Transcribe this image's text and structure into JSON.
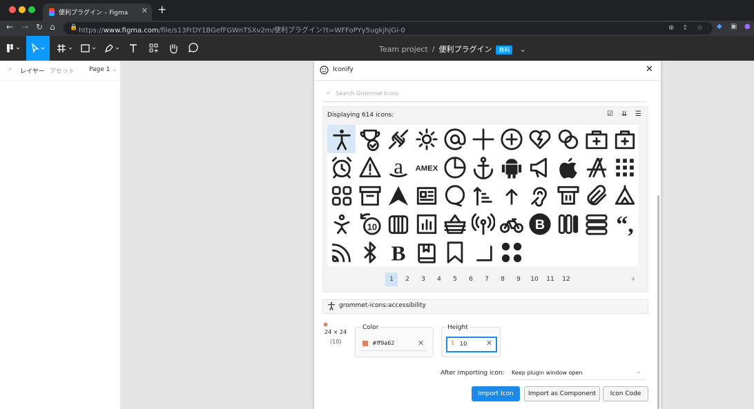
{
  "browser": {
    "tab_title": "便利プラグイン – Figma",
    "tab_close": "✕",
    "new_tab": "+",
    "url_prefix": "https://",
    "url_host": "www.figma.com",
    "url_path": "/file/s13FrDY1BGefFGWnTSXv2m/便利プラグイン?t=WFFoPYy5ugkjhjGi-0"
  },
  "figma": {
    "breadcrumb_team": "Team project",
    "breadcrumb_sep": "/",
    "file_name": "便利プラグイン",
    "badge": "無料",
    "left_tabs": [
      "レイヤー",
      "アセット"
    ],
    "page_selector": "Page 1"
  },
  "plugin": {
    "title": "Iconify",
    "close": "✕",
    "search_placeholder": "Search Grommet Icons",
    "displaying": "Displaying 614 icons:",
    "icons": [
      "accessibility",
      "achievement",
      "action",
      "actions",
      "aed",
      "add",
      "add-circle",
      "aid",
      "aggregate",
      "aid-option",
      "aid-option",
      "alarm",
      "alert",
      "amazon",
      "amex",
      "analytics",
      "anchor",
      "android",
      "announce",
      "apple",
      "apps",
      "apps-rounded",
      "archive",
      "archlinux",
      "article",
      "assist",
      "ascend",
      "ascending",
      "attraction",
      "atm",
      "attachment",
      "attraction",
      "baby",
      "backTen",
      "bar-chart",
      "bar-chart",
      "basket",
      "beacon",
      "bike",
      "bitcoin",
      "blockquote",
      "blockquote",
      "blockquote",
      "blog",
      "bluetooth",
      "bold",
      "book",
      "bookmark",
      "bottom-corner",
      "bowl",
      "briefcase"
    ],
    "pages": [
      "1",
      "2",
      "3",
      "4",
      "5",
      "6",
      "7",
      "8",
      "9",
      "10",
      "11",
      "12"
    ],
    "next_page": "›",
    "selected_icon": "grommet-icons:accessibility",
    "size_label": "24 × 24",
    "size_sub": "(10)",
    "color_label": "Color",
    "color_value": "#ff9a62",
    "height_label": "Height",
    "height_value": "10",
    "after_label": "After importing icon:",
    "after_value": "Keep plugin window open",
    "btn_import": "Import Icon",
    "btn_component": "Import as Component",
    "btn_code": "Icon Code"
  },
  "colors": {
    "accent": "#0d99ff",
    "swatch": "#e0825c",
    "primary_button": "#1e88e5"
  }
}
